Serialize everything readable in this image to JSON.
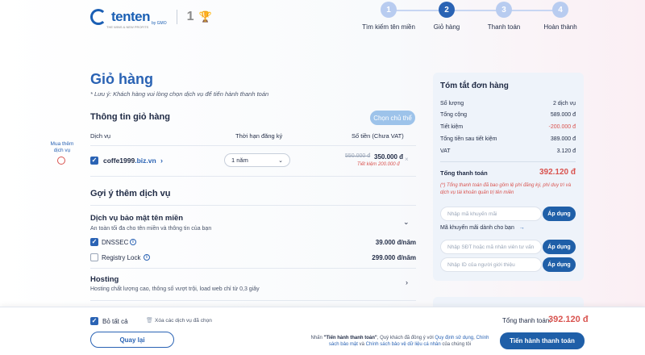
{
  "header": {
    "logo_text": "tenten",
    "logo_by": "by GMO",
    "logo_tagline": "THE WINS & NEW PROFITS",
    "award": "1",
    "steps": [
      {
        "num": "1",
        "label": "Tìm kiếm tên miền",
        "active": false
      },
      {
        "num": "2",
        "label": "Giỏ hàng",
        "active": true
      },
      {
        "num": "3",
        "label": "Thanh toán",
        "active": false
      },
      {
        "num": "4",
        "label": "Hoàn thành",
        "active": false
      }
    ]
  },
  "cart": {
    "title": "Giỏ hàng",
    "note": "* Lưu ý: Khách hàng vui lòng chọn dịch vụ để tiến hành thanh toán",
    "info_title": "Thông tin giỏ hàng",
    "choose_owner_label": "Chọn chủ thể",
    "columns": {
      "service": "Dịch vụ",
      "period": "Thời hạn đăng ký",
      "amount": "Số tiền (Chưa VAT)"
    },
    "side_hint": "Mua thêm dịch vụ",
    "item": {
      "domain_name": "coffe1999",
      "domain_tld": ".biz.vn",
      "period": "1 năm",
      "old_price": "550.000 đ",
      "new_price": "350.000 đ",
      "saving": "Tiết kiệm 200.000 đ",
      "remove_glyph": "×"
    }
  },
  "suggest": {
    "title": "Gợi ý thêm dịch vụ",
    "security": {
      "title": "Dịch vụ bảo mật tên miền",
      "desc": "An toàn tối đa cho tên miền và thông tin của bạn",
      "options": [
        {
          "label": "DNSSEC",
          "price": "39.000 đ/năm",
          "checked": true
        },
        {
          "label": "Registry Lock",
          "price": "299.000 đ/năm",
          "checked": false
        }
      ]
    },
    "hosting": {
      "title": "Hosting",
      "desc": "Hosting chất lượng cao, thông số vượt trội, load web chỉ từ 0,3 giây"
    }
  },
  "summary": {
    "title": "Tóm tắt đơn hàng",
    "rows": [
      {
        "k": "Số lượng",
        "v": "2 dịch vụ",
        "red": false
      },
      {
        "k": "Tổng cộng",
        "v": "589.000 đ",
        "red": false
      },
      {
        "k": "Tiết kiệm",
        "v": "-200.000 đ",
        "red": true
      },
      {
        "k": "Tổng tiền sau tiết kiệm",
        "v": "389.000 đ",
        "red": false
      },
      {
        "k": "VAT",
        "v": "3.120 đ",
        "red": false
      }
    ],
    "total_label": "Tổng thanh toán",
    "total_value": "392.120 đ",
    "note": "(*) Tổng thanh toán đã bao gồm lệ phí đăng ký, phí duy trì và dịch vụ tài khoản quản trị tên miền",
    "promo_placeholder": "Nhập mã khuyến mãi",
    "apply_label": "Áp dụng",
    "promo_link": "Mã khuyến mãi dành cho bạn",
    "staff_placeholder": "Nhập SĐT hoặc mã nhân viên tư vấn",
    "referrer_placeholder": "Nhập ID của người giới thiệu"
  },
  "footer": {
    "select_all": "Bỏ tất cả",
    "clear_selected": "Xóa các dịch vụ đã chọn",
    "back_label": "Quay lại",
    "total_label": "Tổng thanh toán:",
    "total_value": "392.120 đ",
    "proceed_label": "Tiến hành thanh toán",
    "terms_prefix": "Nhấn",
    "terms_action": "\"Tiến hành thanh toán\"",
    "terms_mid": ", Quý khách đã đồng ý với",
    "terms_link1": "Quy định sử dụng",
    "terms_link2": "Chính sách bảo mật",
    "terms_and": "và",
    "terms_link3": "Chính sách bảo vệ dữ liệu cá nhân",
    "terms_suffix": "của chúng tôi"
  },
  "colors": {
    "accent": "#2a63b4",
    "button": "#1f5fa8",
    "danger": "#d9534f",
    "panel": "#eef3fa"
  }
}
